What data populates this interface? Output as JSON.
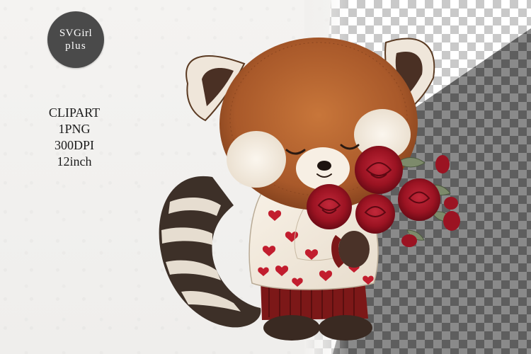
{
  "logo": {
    "line1": "SVGirl",
    "line2": "plus"
  },
  "specs": [
    "CLIPART",
    "1PNG",
    "300DPI",
    "12inch"
  ],
  "colors": {
    "fur": "#b0622d",
    "fur_dark": "#7a3c1a",
    "cream": "#f7efe4",
    "rose": "#9b1322",
    "rose_dark": "#5e0812",
    "leaf": "#7d8a6b",
    "pants": "#7c1818",
    "shoes": "#3a2a22",
    "tail_dark": "#3d3028",
    "tail_light": "#e6ddd0",
    "badge": "#4a4a4a",
    "checker_light": "#ffffff",
    "checker_gray": "#cccccc",
    "shadow_light": "#888888",
    "shadow_dark": "#5f5f5f"
  }
}
